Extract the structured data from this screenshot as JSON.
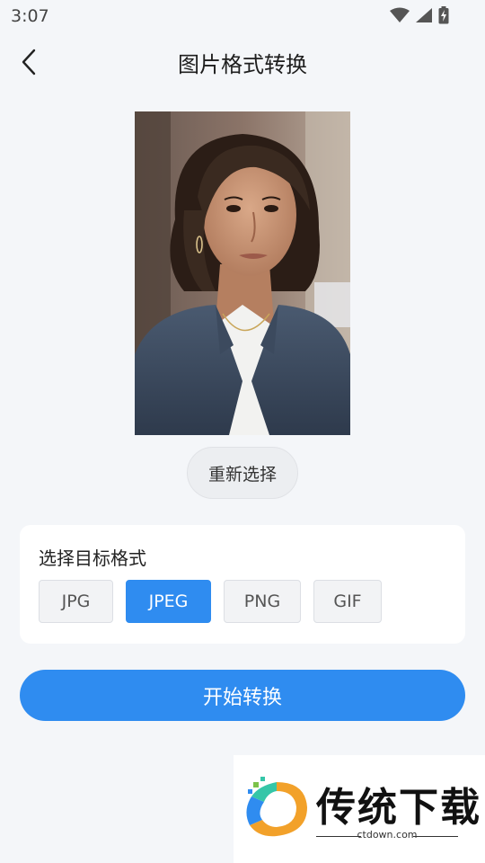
{
  "status_bar": {
    "time": "3:07",
    "icons": [
      "wifi-icon",
      "cell-signal-icon",
      "battery-charging-icon"
    ]
  },
  "app_bar": {
    "back_icon": "chevron-left-icon",
    "title": "图片格式转换"
  },
  "preview": {
    "alt": "portrait photo of a woman in a denim jacket"
  },
  "reselect_label": "重新选择",
  "format_card": {
    "title": "选择目标格式",
    "options": [
      {
        "label": "JPG",
        "selected": false
      },
      {
        "label": "JPEG",
        "selected": true
      },
      {
        "label": "PNG",
        "selected": false
      },
      {
        "label": "GIF",
        "selected": false
      }
    ]
  },
  "start_label": "开始转换",
  "watermark": {
    "brand": "传统下载",
    "domain": "ctdown.com"
  },
  "colors": {
    "accent": "#2f8cf0",
    "background": "#f4f6f9"
  }
}
